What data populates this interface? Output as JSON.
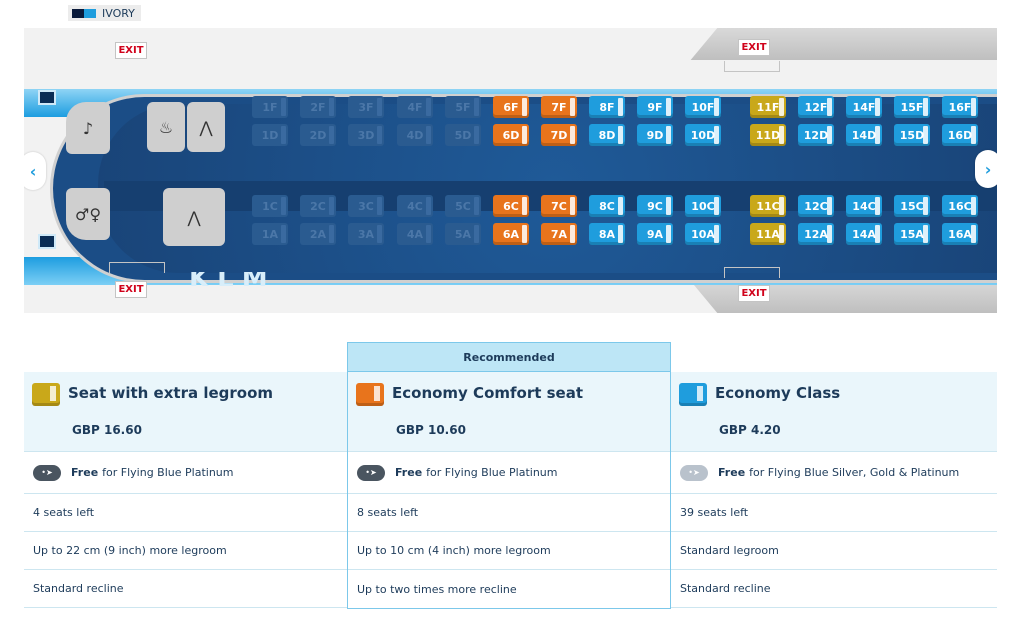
{
  "legend": {
    "label": "IVORY",
    "colors": [
      "#0a1a3a",
      "#1f9ddd"
    ]
  },
  "map": {
    "exit_label": "EXIT",
    "airline_logo": "KLM",
    "nav_prev_icon": "chevron-left-icon",
    "nav_next_icon": "chevron-right-icon",
    "galley_icons": [
      "galley-icon",
      "coat-hanger-icon",
      "lavatory-icon"
    ],
    "colors": {
      "unavailable": "#2a5b90",
      "comfort": "#e8741c",
      "economy": "#1f9ddd",
      "extra_legroom": "#c9a81a"
    }
  },
  "seats": {
    "top_rows": [
      [
        {
          "l": "1F",
          "s": "u"
        },
        {
          "l": "2F",
          "s": "u"
        },
        {
          "l": "3F",
          "s": "u"
        },
        {
          "l": "4F",
          "s": "u"
        },
        {
          "l": "5F",
          "s": "u"
        },
        {
          "l": "6F",
          "s": "o"
        },
        {
          "l": "7F",
          "s": "o"
        },
        {
          "l": "8F",
          "s": "b"
        },
        {
          "l": "9F",
          "s": "b"
        },
        {
          "l": "10F",
          "s": "b"
        },
        {
          "l": "11F",
          "s": "y"
        },
        {
          "l": "12F",
          "s": "b"
        },
        {
          "l": "14F",
          "s": "b"
        },
        {
          "l": "15F",
          "s": "b"
        },
        {
          "l": "16F",
          "s": "b"
        }
      ],
      [
        {
          "l": "1D",
          "s": "u"
        },
        {
          "l": "2D",
          "s": "u"
        },
        {
          "l": "3D",
          "s": "u"
        },
        {
          "l": "4D",
          "s": "u"
        },
        {
          "l": "5D",
          "s": "u"
        },
        {
          "l": "6D",
          "s": "o"
        },
        {
          "l": "7D",
          "s": "o"
        },
        {
          "l": "8D",
          "s": "b"
        },
        {
          "l": "9D",
          "s": "b"
        },
        {
          "l": "10D",
          "s": "b"
        },
        {
          "l": "11D",
          "s": "y"
        },
        {
          "l": "12D",
          "s": "b"
        },
        {
          "l": "14D",
          "s": "b"
        },
        {
          "l": "15D",
          "s": "b"
        },
        {
          "l": "16D",
          "s": "b"
        }
      ]
    ],
    "bottom_rows": [
      [
        {
          "l": "1C",
          "s": "u"
        },
        {
          "l": "2C",
          "s": "u"
        },
        {
          "l": "3C",
          "s": "u"
        },
        {
          "l": "4C",
          "s": "u"
        },
        {
          "l": "5C",
          "s": "u"
        },
        {
          "l": "6C",
          "s": "o"
        },
        {
          "l": "7C",
          "s": "o"
        },
        {
          "l": "8C",
          "s": "b"
        },
        {
          "l": "9C",
          "s": "b"
        },
        {
          "l": "10C",
          "s": "b"
        },
        {
          "l": "11C",
          "s": "y"
        },
        {
          "l": "12C",
          "s": "b"
        },
        {
          "l": "14C",
          "s": "b"
        },
        {
          "l": "15C",
          "s": "b"
        },
        {
          "l": "16C",
          "s": "b"
        }
      ],
      [
        {
          "l": "1A",
          "s": "u"
        },
        {
          "l": "2A",
          "s": "u"
        },
        {
          "l": "3A",
          "s": "u"
        },
        {
          "l": "4A",
          "s": "u"
        },
        {
          "l": "5A",
          "s": "u"
        },
        {
          "l": "6A",
          "s": "o"
        },
        {
          "l": "7A",
          "s": "o"
        },
        {
          "l": "8A",
          "s": "b"
        },
        {
          "l": "9A",
          "s": "b"
        },
        {
          "l": "10A",
          "s": "b"
        },
        {
          "l": "11A",
          "s": "y"
        },
        {
          "l": "12A",
          "s": "b"
        },
        {
          "l": "14A",
          "s": "b"
        },
        {
          "l": "15A",
          "s": "b"
        },
        {
          "l": "16A",
          "s": "b"
        }
      ]
    ]
  },
  "recommended_label": "Recommended",
  "options": [
    {
      "title": "Seat with extra legroom",
      "price": "GBP 16.60",
      "color": "#c9a81a",
      "free_bold": "Free",
      "free_text": "for Flying Blue Platinum",
      "seats_left": "4 seats left",
      "legroom": "Up to 22 cm (9 inch) more legroom",
      "recline": "Standard recline"
    },
    {
      "title": "Economy Comfort seat",
      "price": "GBP 10.60",
      "color": "#e8741c",
      "free_bold": "Free",
      "free_text": "for Flying Blue Platinum",
      "seats_left": "8 seats left",
      "legroom": "Up to 10 cm (4 inch) more legroom",
      "recline": "Up to two times more recline"
    },
    {
      "title": "Economy Class",
      "price": "GBP 4.20",
      "color": "#1f9ddd",
      "free_bold": "Free",
      "free_text": "for Flying Blue Silver, Gold & Platinum",
      "seats_left": "39 seats left",
      "legroom": "Standard legroom",
      "recline": "Standard recline"
    }
  ]
}
